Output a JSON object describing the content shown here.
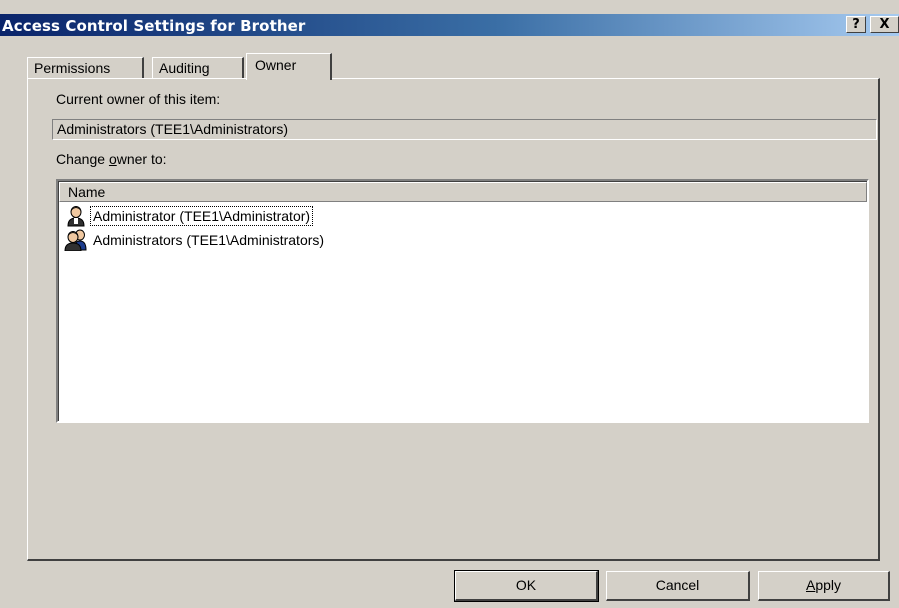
{
  "window": {
    "title": "Access Control Settings for Brother",
    "help_btn": "?",
    "close_btn": "X"
  },
  "tabs": [
    {
      "label": "Permissions",
      "active": false
    },
    {
      "label": "Auditing",
      "active": false
    },
    {
      "label": "Owner",
      "active": true
    }
  ],
  "owner": {
    "current_label": "Current owner of this item:",
    "current_value": "Administrators (TEE1\\Administrators)",
    "change_label_pre": "Change ",
    "change_label_accel": "o",
    "change_label_post": "wner to:"
  },
  "list": {
    "column_header": "Name",
    "items": [
      {
        "label": "Administrator (TEE1\\Administrator)",
        "icon": "user-icon"
      },
      {
        "label": "Administrators (TEE1\\Administrators)",
        "icon": "group-icon"
      }
    ]
  },
  "buttons": {
    "ok": "OK",
    "cancel": "Cancel",
    "apply_accel": "A",
    "apply_rest": "pply"
  }
}
